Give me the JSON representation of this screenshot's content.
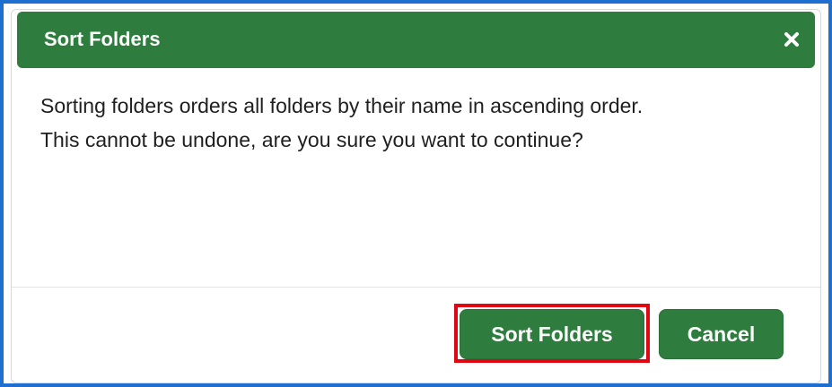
{
  "dialog": {
    "title": "Sort Folders",
    "close_icon": "close-icon",
    "message_line_1": "Sorting folders orders all folders by their name in ascending order.",
    "message_line_2": "This cannot be undone, are you sure you want to continue?",
    "primary_button": "Sort Folders",
    "cancel_button": "Cancel"
  },
  "colors": {
    "frame": "#1f6fd0",
    "header": "#2f7d3e",
    "button": "#2f7d3e",
    "highlight": "#e10612",
    "text": "#1f1f1f"
  }
}
